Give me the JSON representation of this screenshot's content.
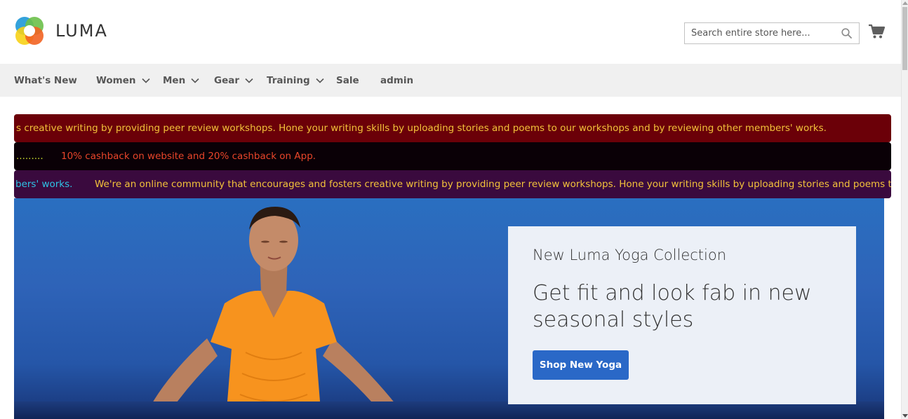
{
  "header": {
    "logo_text": "LUMA",
    "search_placeholder": "Search entire store here...",
    "cart_icon": "shopping-cart-icon"
  },
  "nav": {
    "items": [
      {
        "label": "What's New",
        "has_dropdown": false
      },
      {
        "label": "Women",
        "has_dropdown": true
      },
      {
        "label": "Men",
        "has_dropdown": true
      },
      {
        "label": "Gear",
        "has_dropdown": true
      },
      {
        "label": "Training",
        "has_dropdown": true
      },
      {
        "label": "Sale",
        "has_dropdown": false
      },
      {
        "label": "admin",
        "has_dropdown": false
      }
    ]
  },
  "marquees": [
    {
      "text": "s creative writing by providing peer review workshops. Hone your writing skills by uploading stories and poems to our workshops and by reviewing other members' works.",
      "bg": "#6b0008",
      "color": "#f3c23a"
    },
    {
      "text_a": ".........",
      "text_b": "10% cashback on website and 20% cashback on App.",
      "bg": "#0a0006",
      "color_a": "#c8d630",
      "color_b": "#e8452a"
    },
    {
      "text_a": "bers' works.",
      "text_b": "We're an online community that encourages and fosters creative writing by providing peer review workshops. Hone your writing skills by uploading stories and poems to our w",
      "bg": "#3a0a3e",
      "color_a": "#2ec3e6",
      "color_b": "#f3c23a"
    }
  ],
  "hero": {
    "kicker": "New Luma Yoga Collection",
    "title": "Get fit and look fab in new seasonal styles",
    "button_label": "Shop New Yoga",
    "button_color": "#2a68c7"
  }
}
